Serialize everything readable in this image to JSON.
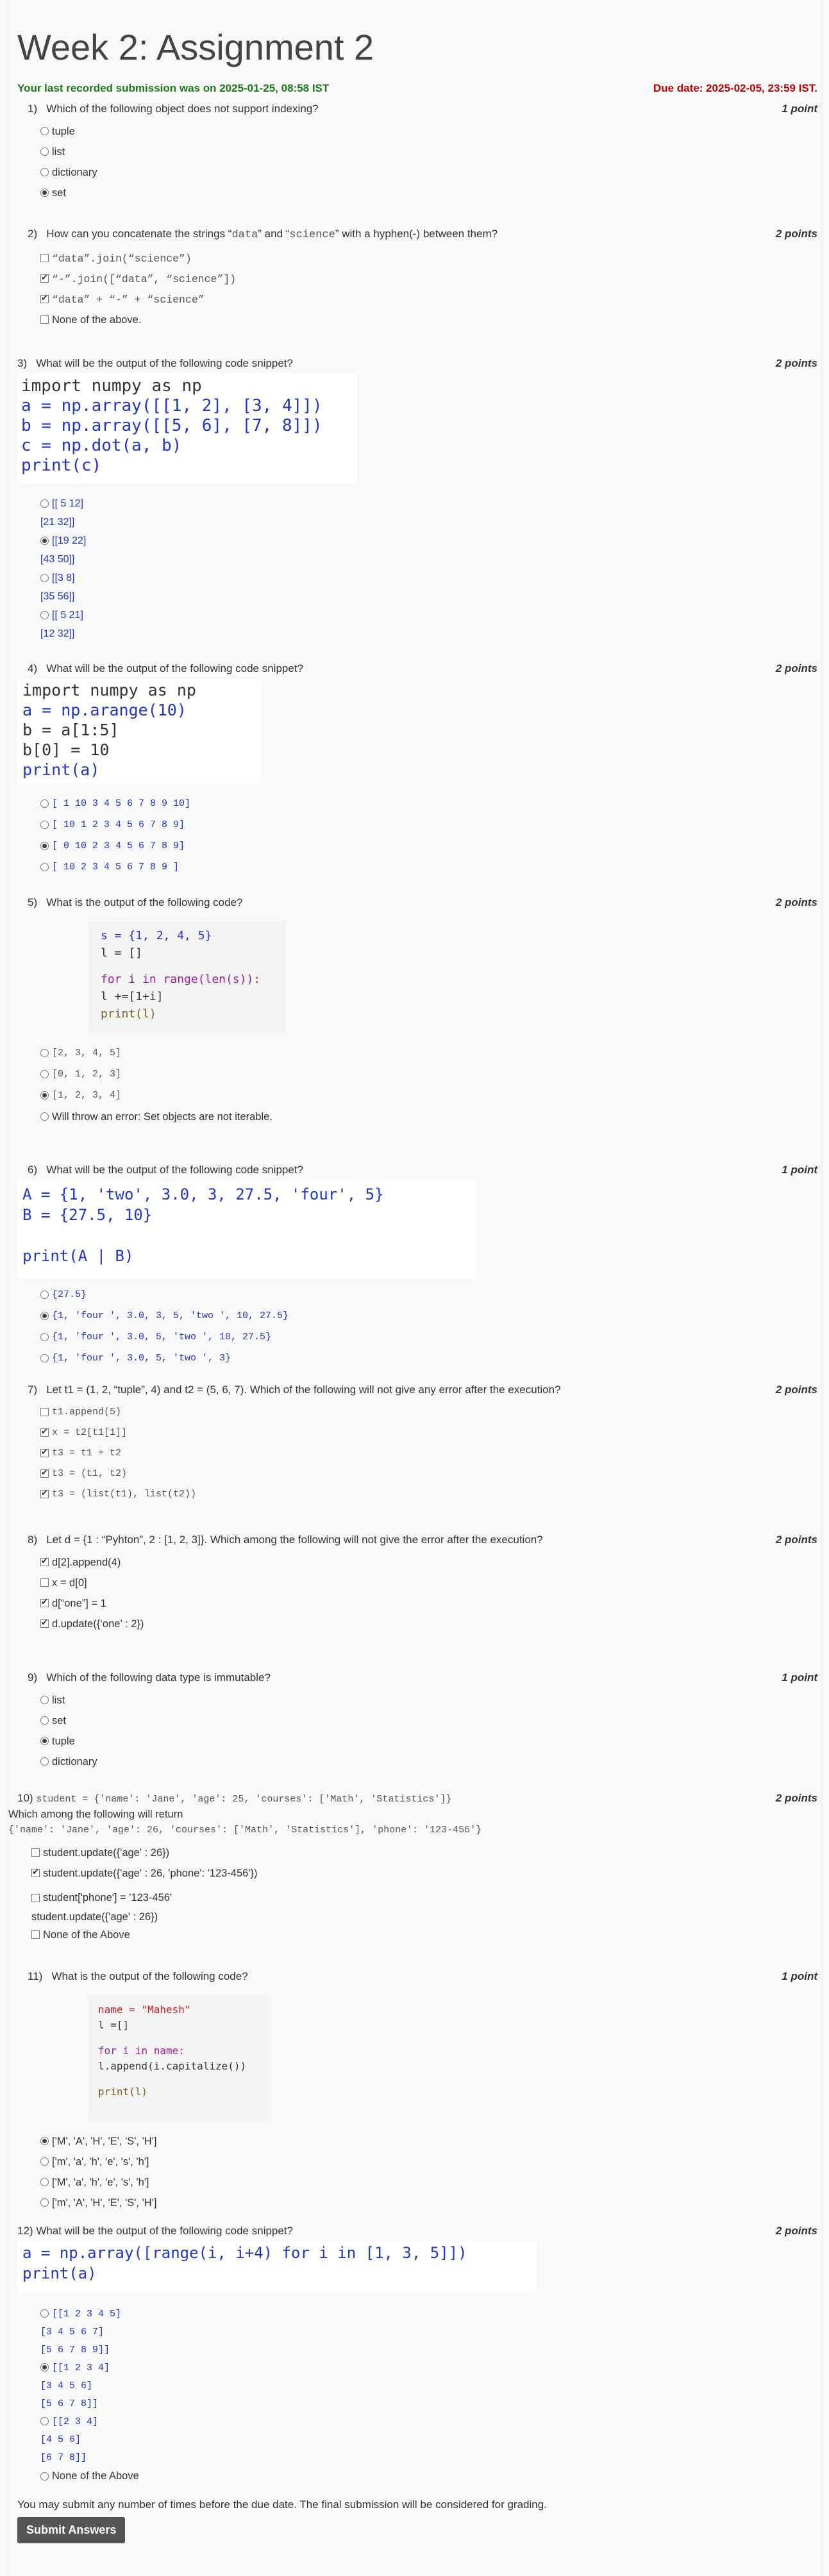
{
  "page": {
    "title": "Week 2: Assignment 2",
    "last_submission": "Your last recorded submission was on 2025-01-25, 08:58 IST",
    "due_date": "Due date: 2025-02-05, 23:59 IST."
  },
  "q1": {
    "num": "1)",
    "text": "Which of the following object does not support indexing?",
    "points": "1 point",
    "options": [
      "tuple",
      "list",
      "dictionary",
      "set"
    ]
  },
  "q2": {
    "num": "2)",
    "text_a": "How can you concatenate the strings “",
    "s1": "data",
    "text_b": "” and “",
    "s2": "science",
    "text_c": "” with a hyphen(-) between them?",
    "points": "2 points",
    "options": [
      "“data”.join(“science”)",
      "“-”.join([“data”, “science”])",
      "“data” + “-” + “science”",
      "None of the above."
    ]
  },
  "q3": {
    "num": "3)",
    "text": "What will be the output of the following code snippet?",
    "points": "2 points",
    "code": [
      "import numpy as np",
      "a = np.array([[1, 2], [3, 4]])",
      "b = np.array([[5, 6], [7, 8]])",
      "c = np.dot(a, b)",
      "print(c)"
    ],
    "options": [
      [
        "[[ 5 12]",
        "[21 32]]"
      ],
      [
        "[[19 22]",
        "[43 50]]"
      ],
      [
        "[[3 8]",
        "[35 56]]"
      ],
      [
        "[[ 5 21]",
        "[12 32]]"
      ]
    ]
  },
  "q4": {
    "num": "4)",
    "text": "What will be the output of the following code snippet?",
    "points": "2 points",
    "code": [
      "import numpy as np",
      "a = np.arange(10)",
      "b = a[1:5]",
      "b[0] = 10",
      "print(a)"
    ],
    "options": [
      "[ 1 10 3 4 5 6 7 8 9 10]",
      "[ 10 1 2 3 4 5 6 7 8 9]",
      "[ 0 10 2 3 4 5 6 7 8 9]",
      "[ 10 2 3 4 5 6 7 8 9 ]"
    ]
  },
  "q5": {
    "num": "5)",
    "text": "What is the output of the following code?",
    "points": "2 points",
    "code": [
      "s = {1, 2, 4, 5}",
      "l = []",
      "",
      "for i in range(len(s)):",
      "  l +=[1+i]",
      "print(l)"
    ],
    "options": [
      "[2, 3, 4, 5]",
      "[0, 1, 2, 3]",
      "[1, 2, 3, 4]",
      "Will throw an error: Set objects are not iterable."
    ]
  },
  "q6": {
    "num": "6)",
    "text": "What will be the output of the following code snippet?",
    "points": "1 point",
    "code": [
      "A = {1, 'two', 3.0, 3, 27.5, 'four', 5}",
      "B = {27.5, 10}",
      "",
      "print(A | B)"
    ],
    "options": [
      "{27.5}",
      "{1, 'four ', 3.0, 3, 5, 'two ', 10, 27.5}",
      "{1, 'four ', 3.0, 5, 'two ', 10, 27.5}",
      "{1, 'four ', 3.0, 5, 'two ', 3}"
    ]
  },
  "q7": {
    "num": "7)",
    "text": "Let t1 = (1, 2, “tuple”, 4) and t2 = (5, 6, 7). Which of the following will not give any error after the execution?",
    "points": "2 points",
    "options": [
      "t1.append(5)",
      "x = t2[t1[1]]",
      "t3 = t1 + t2",
      "t3 = (t1, t2)",
      "t3 = (list(t1), list(t2))"
    ]
  },
  "q8": {
    "num": "8)",
    "text": "Let d = {1 : “Pyhton”, 2 : [1, 2, 3]}. Which among the following will not give the error after the execution?",
    "points": "2 points",
    "options": [
      "d[2].append(4)",
      "x = d[0]",
      "d[“one”] = 1",
      "d.update({‘one’ : 2})"
    ]
  },
  "q9": {
    "num": "9)",
    "text": "Which of the following data type is immutable?",
    "points": "1 point",
    "options": [
      "list",
      "set",
      "tuple",
      "dictionary"
    ]
  },
  "q10": {
    "num": "10)",
    "text_code": "student = {'name': 'Jane', 'age': 25, 'courses': ['Math', 'Statistics']}",
    "points": "2 points",
    "text2": "Which among the following will return",
    "text3": "{'name': 'Jane', 'age': 26, 'courses': ['Math', 'Statistics'], 'phone': '123-456'}",
    "options": [
      "student.update({'age' : 26})",
      "student.update({'age' : 26, 'phone': '123-456'})",
      "student['phone'] = '123-456'",
      "student.update({'age' : 26})",
      "None of the Above"
    ]
  },
  "q11": {
    "num": "11)",
    "text": "What is the output of the following code?",
    "points": "1 point",
    "code": [
      "name = \"Mahesh\"",
      "l =[]",
      "",
      "for i in name:",
      "  l.append(i.capitalize())",
      "",
      "print(l)"
    ],
    "options": [
      "['M', 'A', 'H', 'E', 'S', 'H']",
      "['m', 'a', 'h', 'e', 's', 'h']",
      "['M', 'a', 'h', 'e', 's', 'h']",
      "['m', 'A', 'H', 'E', 'S', 'H']"
    ]
  },
  "q12": {
    "num": "12)",
    "text": "What will be the output of the following code snippet?",
    "points": "2 points",
    "code": [
      "a = np.array([range(i, i+4) for i in [1, 3, 5]])",
      "print(a)"
    ],
    "options": [
      [
        "[[1 2 3 4 5]",
        "[3 4 5 6 7]",
        "[5 6 7 8 9]]"
      ],
      [
        "[[1 2 3 4]",
        "[3 4 5 6]",
        "[5 6 7 8]]"
      ],
      [
        "[[2 3 4]",
        "[4 5 6]",
        "[6 7 8]]"
      ],
      [
        "None of the Above"
      ]
    ]
  },
  "footer": {
    "note": "You may submit any number of times before the due date. The final submission will be considered for grading.",
    "submit": "Submit Answers"
  }
}
